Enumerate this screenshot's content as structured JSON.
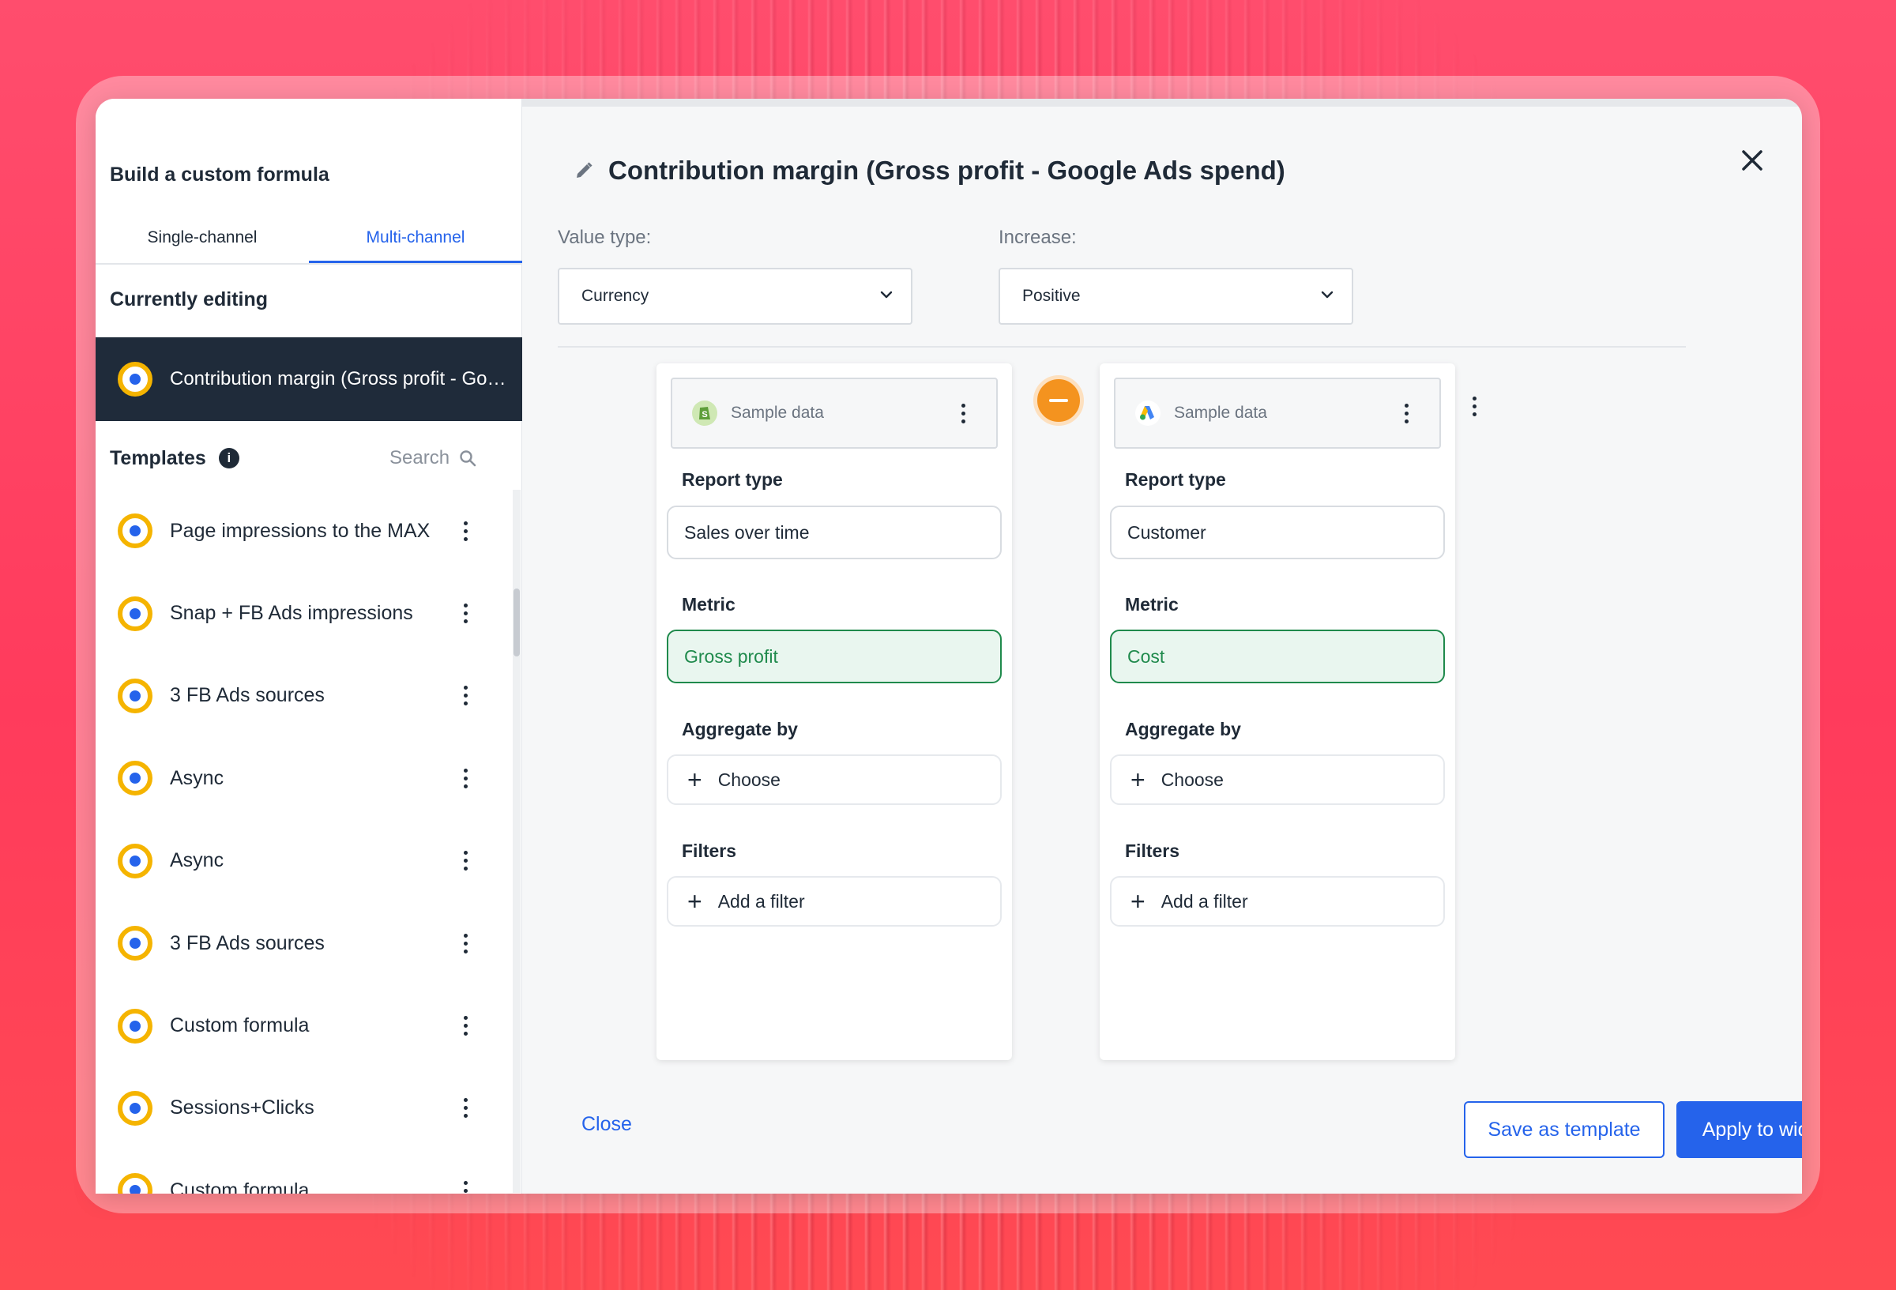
{
  "sidebar": {
    "title": "Build a custom formula",
    "tabs": [
      {
        "label": "Single-channel",
        "active": false
      },
      {
        "label": "Multi-channel",
        "active": true
      }
    ],
    "editing_heading": "Currently editing",
    "editing_item": "Contribution margin (Gross profit - Google Ads spend)",
    "templates_heading": "Templates",
    "search_label": "Search",
    "templates": [
      "Page impressions to the MAX",
      "Snap + FB Ads impressions",
      "3 FB Ads sources",
      "Async",
      "Async",
      "3 FB Ads sources",
      "Custom formula",
      "Sessions+Clicks",
      "Custom formula"
    ]
  },
  "main": {
    "title": "Contribution margin (Gross profit - Google Ads spend)",
    "value_type_label": "Value type:",
    "value_type": "Currency",
    "increase_label": "Increase:",
    "increase": "Positive",
    "cards": [
      {
        "source": "Sample data",
        "source_icon": "shopify-icon",
        "report_type_label": "Report type",
        "report_type": "Sales over time",
        "metric_label": "Metric",
        "metric": "Gross profit",
        "aggregate_label": "Aggregate by",
        "aggregate_placeholder": "Choose",
        "filters_label": "Filters",
        "filters_placeholder": "Add a filter"
      },
      {
        "source": "Sample data",
        "source_icon": "google-ads-icon",
        "report_type_label": "Report type",
        "report_type": "Customer",
        "metric_label": "Metric",
        "metric": "Cost",
        "aggregate_label": "Aggregate by",
        "aggregate_placeholder": "Choose",
        "filters_label": "Filters",
        "filters_placeholder": "Add a filter"
      }
    ],
    "operator": "minus",
    "close_label": "Close",
    "save_label": "Save as template",
    "apply_label": "Apply to widget"
  },
  "colors": {
    "accent": "#2563eb",
    "sidebar_dark": "#1f2b3a",
    "metric_green": "#1f8a4c",
    "operator_orange": "#f4931f",
    "ring_yellow": "#f5b400"
  }
}
